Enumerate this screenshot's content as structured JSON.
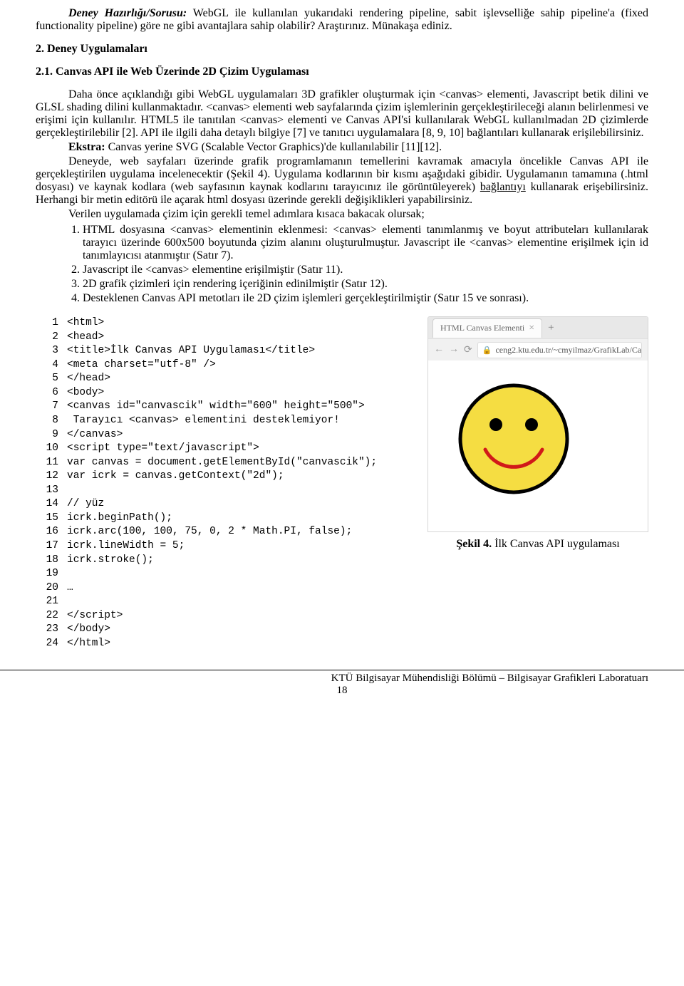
{
  "top_para": {
    "prefix_bi": "Deney Hazırlığı/Sorusu:",
    "rest": " WebGL ile kullanılan yukarıdaki rendering pipeline, sabit işlevselliğe sahip pipeline'a (fixed functionality pipeline) göre ne gibi avantajlara sahip olabilir? Araştırınız. Münakaşa ediniz."
  },
  "h2": "2. Deney Uygulamaları",
  "h21": "2.1. Canvas API ile Web Üzerinde 2D Çizim Uygulaması",
  "p1": "Daha önce açıklandığı gibi WebGL uygulamaları 3D grafikler oluşturmak için <canvas> elementi, Javascript betik dilini ve GLSL shading dilini kullanmaktadır. <canvas> elementi web sayfalarında çizim işlemlerinin gerçekleştirileceği alanın belirlenmesi ve erişimi için kullanılır. HTML5 ile tanıtılan <canvas> elementi ve Canvas API'si kullanılarak WebGL kullanılmadan 2D çizimlerde gerçekleştirilebilir [2]. API ile ilgili daha detaylı bilgiye [7] ve tanıtıcı uygulamalara [8, 9, 10] bağlantıları kullanarak erişilebilirsiniz.",
  "p2_prefix": "Ekstra:",
  "p2_rest": " Canvas yerine SVG (Scalable Vector Graphics)'de kullanılabilir [11][12].",
  "p3_a": "Deneyde, web sayfaları üzerinde grafik programlamanın temellerini kavramak amacıyla öncelikle Canvas API ile gerçekleştirilen uygulama incelenecektir (Şekil 4). Uygulama kodlarının bir kısmı aşağıdaki gibidir. Uygulamanın tamamına (.html dosyası) ve kaynak kodlara (web sayfasının kaynak kodlarını tarayıcınız ile görüntüleyerek) ",
  "p3_link": "bağlantıyı",
  "p3_b": " kullanarak erişebilirsiniz. Herhangi bir metin editörü ile açarak html dosyası üzerinde gerekli değişiklikleri yapabilirsiniz.",
  "p4": "Verilen uygulamada çizim için gerekli temel adımlara kısaca bakacak olursak;",
  "steps": [
    "HTML dosyasına <canvas> elementinin eklenmesi: <canvas> elementi tanımlanmış ve boyut attributeları kullanılarak tarayıcı üzerinde 600x500 boyutunda çizim alanını oluşturulmuştur. Javascript ile <canvas> elementine erişilmek için id tanımlayıcısı atanmıştır (Satır 7).",
    "Javascript ile <canvas> elementine erişilmiştir (Satır 11).",
    "2D grafik çizimleri için rendering içeriğinin edinilmiştir (Satır 12).",
    "Desteklenen Canvas API metotları ile 2D çizim işlemleri gerçekleştirilmiştir (Satır 15 ve sonrası)."
  ],
  "code": [
    "<html>",
    "<head>",
    "<title>İlk Canvas API Uygulaması</title>",
    "<meta charset=\"utf-8\" />",
    "</head>",
    "<body>",
    "<canvas id=\"canvascik\" width=\"600\" height=\"500\">",
    " Tarayıcı <canvas> elementini desteklemiyor!",
    "</canvas>",
    "<script type=\"text/javascript\">",
    "var canvas = document.getElementById(\"canvascik\");",
    "var icrk = canvas.getContext(\"2d\");",
    "",
    "// yüz",
    "icrk.beginPath();",
    "icrk.arc(100, 100, 75, 0, 2 * Math.PI, false);",
    "icrk.lineWidth = 5;",
    "icrk.stroke();",
    "",
    "…",
    "",
    "</script>",
    "</body>",
    "</html>"
  ],
  "browser": {
    "tab_title": "HTML Canvas Elementi",
    "url": "ceng2.ktu.edu.tr/~cmyilmaz/GrafikLab/Ca"
  },
  "caption_b": "Şekil 4.",
  "caption_rest": " İlk Canvas API uygulaması",
  "footer": "KTÜ Bilgisayar Mühendisliği Bölümü – Bilgisayar Grafikleri Laboratuarı",
  "page_num": "18"
}
